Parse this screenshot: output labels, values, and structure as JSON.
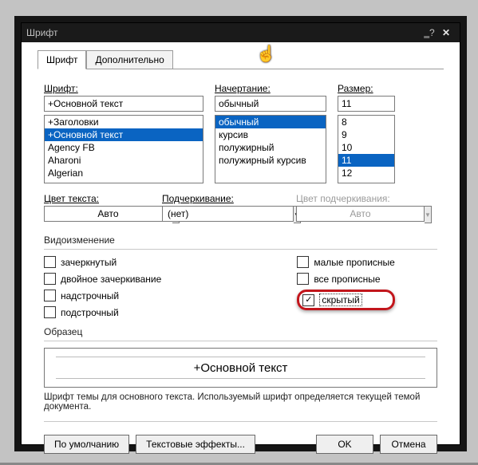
{
  "window": {
    "title": "Шрифт"
  },
  "tabs": {
    "font": "Шрифт",
    "advanced": "Дополнительно"
  },
  "font": {
    "label": "Шрифт:",
    "value": "+Основной текст",
    "options": [
      "+Заголовки",
      "+Основной текст",
      "Agency FB",
      "Aharoni",
      "Algerian"
    ],
    "selected": "+Основной текст"
  },
  "style": {
    "label": "Начертание:",
    "value": "обычный",
    "options": [
      "обычный",
      "курсив",
      "полужирный",
      "полужирный курсив"
    ],
    "selected": "обычный"
  },
  "size": {
    "label": "Размер:",
    "value": "11",
    "options": [
      "8",
      "9",
      "10",
      "11",
      "12"
    ],
    "selected": "11"
  },
  "color": {
    "label": "Цвет текста:",
    "value": "Авто"
  },
  "underline": {
    "label": "Подчеркивание:",
    "value": "(нет)"
  },
  "ucolor": {
    "label": "Цвет подчеркивания:",
    "value": "Авто"
  },
  "effects": {
    "legend": "Видоизменение",
    "left": [
      "зачеркнутый",
      "двойное зачеркивание",
      "надстрочный",
      "подстрочный"
    ],
    "right": [
      "малые прописные",
      "все прописные",
      "скрытый"
    ],
    "checked": "скрытый"
  },
  "sample": {
    "legend": "Образец",
    "text": "+Основной текст",
    "desc": "Шрифт темы для основного текста. Используемый шрифт определяется текущей темой документа."
  },
  "buttons": {
    "default": "По умолчанию",
    "text_effects": "Текстовые эффекты...",
    "ok": "OK",
    "cancel": "Отмена"
  }
}
